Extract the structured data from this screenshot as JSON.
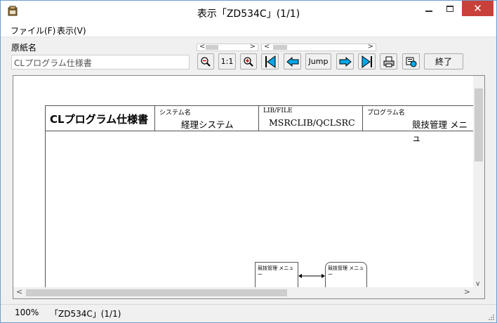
{
  "window": {
    "title": "表示「ZD534C」(1/1)"
  },
  "menu": {
    "file": "ファイル(F)",
    "view": "表示(V)"
  },
  "form": {
    "label": "原紙名",
    "value": "CLプログラム仕様書"
  },
  "toolbar": {
    "zoom_reset_label": "1:1",
    "jump_label": "Jump",
    "exit_label": "終了"
  },
  "document": {
    "title": "CLプログラム仕様書",
    "system_label": "システム名",
    "system_value": "経理システム",
    "lib_label": "LIB/FILE",
    "lib_value": "MSRCLIB/QCLSRC",
    "program_label": "プログラム名",
    "program_value": "競技管理 メニュ",
    "box1_text": "競技管理 メニュー",
    "box2_text": "競技管理 メニュー"
  },
  "status": {
    "zoom": "100%",
    "page": "「ZD534C」(1/1)"
  },
  "colors": {
    "close_button": "#c7403a",
    "accent_icon": "#00a8e8"
  }
}
